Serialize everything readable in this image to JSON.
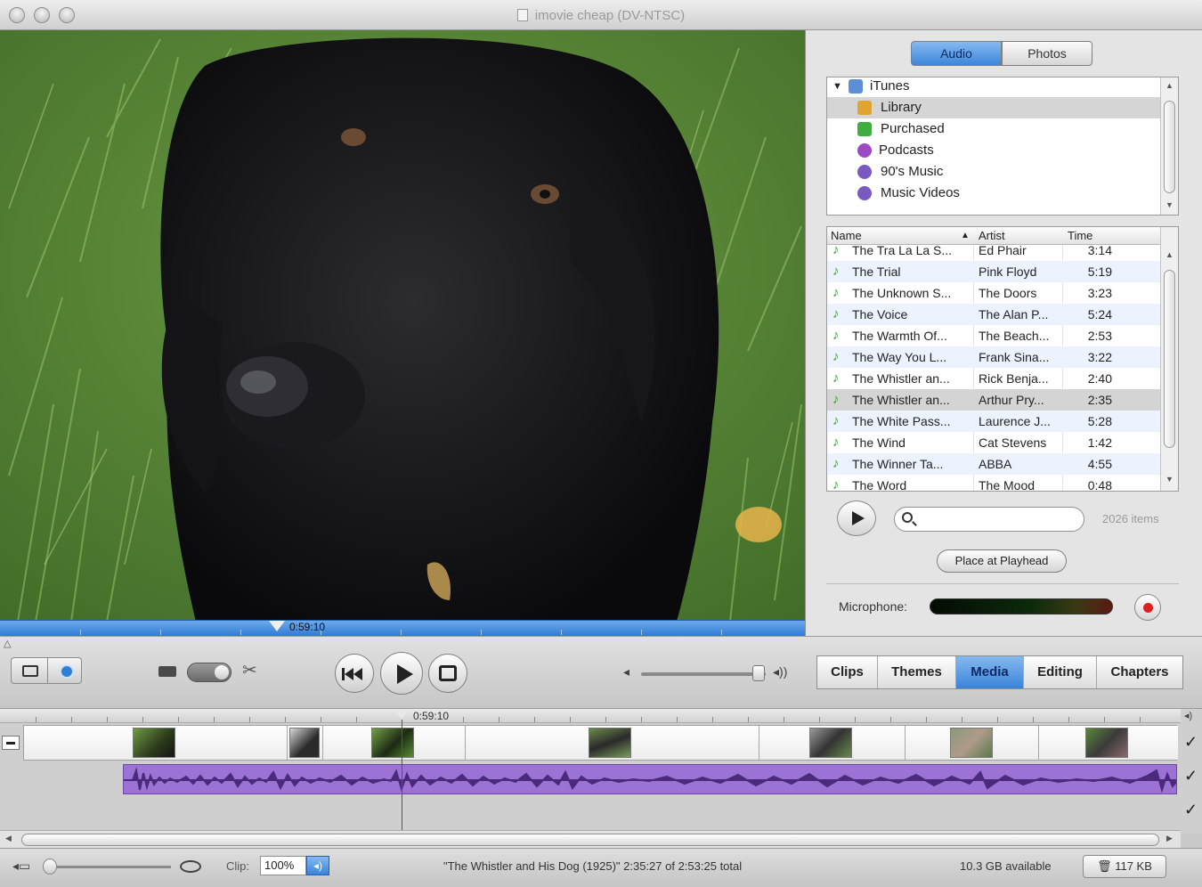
{
  "window": {
    "title": "imovie cheap (DV-NTSC)"
  },
  "viewer": {
    "playhead_time": "0:59:10"
  },
  "media_pane": {
    "segments": [
      {
        "label": "Audio",
        "selected": true
      },
      {
        "label": "Photos",
        "selected": false
      }
    ],
    "sources": [
      {
        "label": "iTunes",
        "icon": "itunes-icon",
        "level": 0
      },
      {
        "label": "Library",
        "icon": "library-icon",
        "level": 1,
        "selected": true
      },
      {
        "label": "Purchased",
        "icon": "purchased-icon",
        "level": 1
      },
      {
        "label": "Podcasts",
        "icon": "podcast-icon",
        "level": 1
      },
      {
        "label": "90's Music",
        "icon": "smart-playlist-icon",
        "level": 1
      },
      {
        "label": "Music Videos",
        "icon": "smart-playlist-icon",
        "level": 1
      }
    ],
    "columns": {
      "name": "Name",
      "artist": "Artist",
      "time": "Time"
    },
    "songs": [
      {
        "name": "The Tra La La S...",
        "artist": "Ed Phair",
        "time": "3:14"
      },
      {
        "name": "The Trial",
        "artist": "Pink Floyd",
        "time": "5:19"
      },
      {
        "name": "The Unknown S...",
        "artist": "The Doors",
        "time": "3:23"
      },
      {
        "name": "The Voice",
        "artist": "The Alan P...",
        "time": "5:24"
      },
      {
        "name": "The Warmth Of...",
        "artist": "The Beach...",
        "time": "2:53"
      },
      {
        "name": "The Way You L...",
        "artist": "Frank Sina...",
        "time": "3:22"
      },
      {
        "name": "The Whistler an...",
        "artist": "Rick Benja...",
        "time": "2:40"
      },
      {
        "name": "The Whistler an...",
        "artist": "Arthur Pry...",
        "time": "2:35",
        "selected": true
      },
      {
        "name": "The White Pass...",
        "artist": "Laurence J...",
        "time": "5:28"
      },
      {
        "name": "The Wind",
        "artist": "Cat Stevens",
        "time": "1:42"
      },
      {
        "name": "The Winner Ta...",
        "artist": "ABBA",
        "time": "4:55"
      },
      {
        "name": "The Word",
        "artist": "The Mood",
        "time": "0:48"
      }
    ],
    "search_placeholder": "",
    "item_count": "2026 items",
    "place_button": "Place at Playhead",
    "microphone_label": "Microphone:"
  },
  "controls": {
    "tabs": [
      {
        "label": "Clips",
        "selected": false
      },
      {
        "label": "Themes",
        "selected": false
      },
      {
        "label": "Media",
        "selected": true
      },
      {
        "label": "Editing",
        "selected": false
      },
      {
        "label": "Chapters",
        "selected": false
      }
    ]
  },
  "timeline": {
    "playhead_time": "0:59:10"
  },
  "status": {
    "clip_label": "Clip:",
    "clip_volume": "100%",
    "info": "\"The Whistler and His Dog (1925)\"  2:35:27 of 2:53:25 total",
    "disk": "10.3 GB available",
    "trash": "117 KB"
  },
  "colors": {
    "accent_blue": "#3a83d8",
    "audio_track": "#9c72d4",
    "record_red": "#e02020"
  }
}
